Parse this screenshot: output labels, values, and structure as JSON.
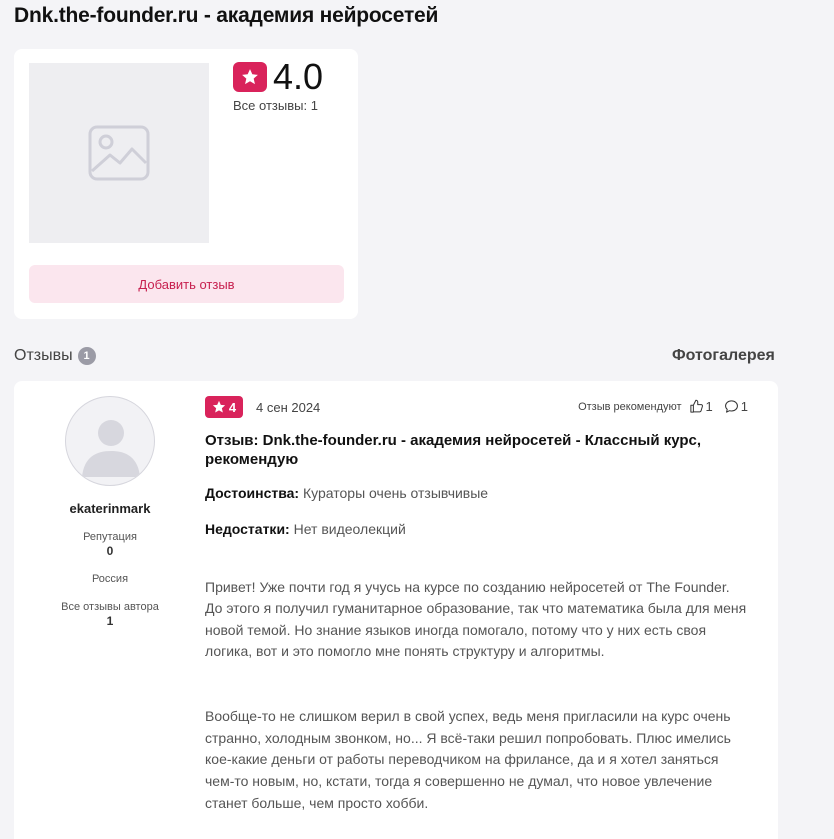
{
  "page": {
    "title": "Dnk.the-founder.ru - академия нейросетей"
  },
  "summary": {
    "rating": "4.0",
    "total_reviews": "Все отзывы: 1",
    "add_review_label": "Добавить отзыв"
  },
  "section": {
    "reviews_label": "Отзывы",
    "reviews_count": "1",
    "gallery_label": "Фотогалерея"
  },
  "review": {
    "author": {
      "name": "ekaterinmark",
      "reputation_label": "Репутация",
      "reputation_value": "0",
      "country": "Россия",
      "all_reviews_label": "Все отзывы автора",
      "all_reviews_value": "1"
    },
    "rating": "4",
    "date": "4 сен 2024",
    "recommend_label": "Отзыв рекомендуют",
    "likes": "1",
    "comments": "1",
    "title": "Отзыв: Dnk.the-founder.ru - академия нейросетей - Классный курс, рекомендую",
    "pros_label": "Достоинства:",
    "pros": "Кураторы очень отзывчивые",
    "cons_label": "Недостатки:",
    "cons": "Нет видеолекций",
    "paragraph_1": "Привет! Уже почти год я учусь на курсе по созданию нейросетей от The Founder. До этого я получил гуманитарное образование, так что математика была для меня новой темой. Но знание языков иногда помогало, потому что у них есть своя логика, вот и это помогло мне понять структуру и алгоритмы.",
    "paragraph_2": "Вообще-то не слишком верил в свой успех, ведь меня пригласили на курс очень странно, холодным звонком, но... Я всё-таки решил попробовать. Плюс имелись кое-какие деньги от работы переводчиком на фрилансе, да и я хотел заняться чем-то новым, но, кстати, тогда я совершенно не думал, что новое увлечение станет больше, чем просто хобби."
  },
  "colors": {
    "accent": "#d9235b",
    "accent_light": "#fbe6ee",
    "page_bg": "#f4f4f7"
  },
  "icons": {
    "rating": "star-icon",
    "placeholder": "image-placeholder-icon",
    "like": "thumb-up-icon",
    "comment": "comment-icon",
    "avatar": "user-silhouette-icon"
  }
}
